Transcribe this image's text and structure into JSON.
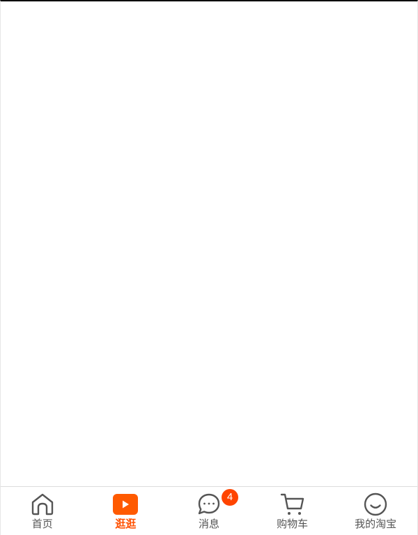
{
  "tabbar": {
    "accent_color": "#ff5000",
    "items": [
      {
        "label": "首页",
        "icon": "home-icon"
      },
      {
        "label": "逛逛",
        "icon": "play-icon",
        "active": true
      },
      {
        "label": "消息",
        "icon": "message-icon",
        "badge": "4"
      },
      {
        "label": "购物车",
        "icon": "cart-icon"
      },
      {
        "label": "我的淘宝",
        "icon": "smile-icon"
      }
    ]
  }
}
